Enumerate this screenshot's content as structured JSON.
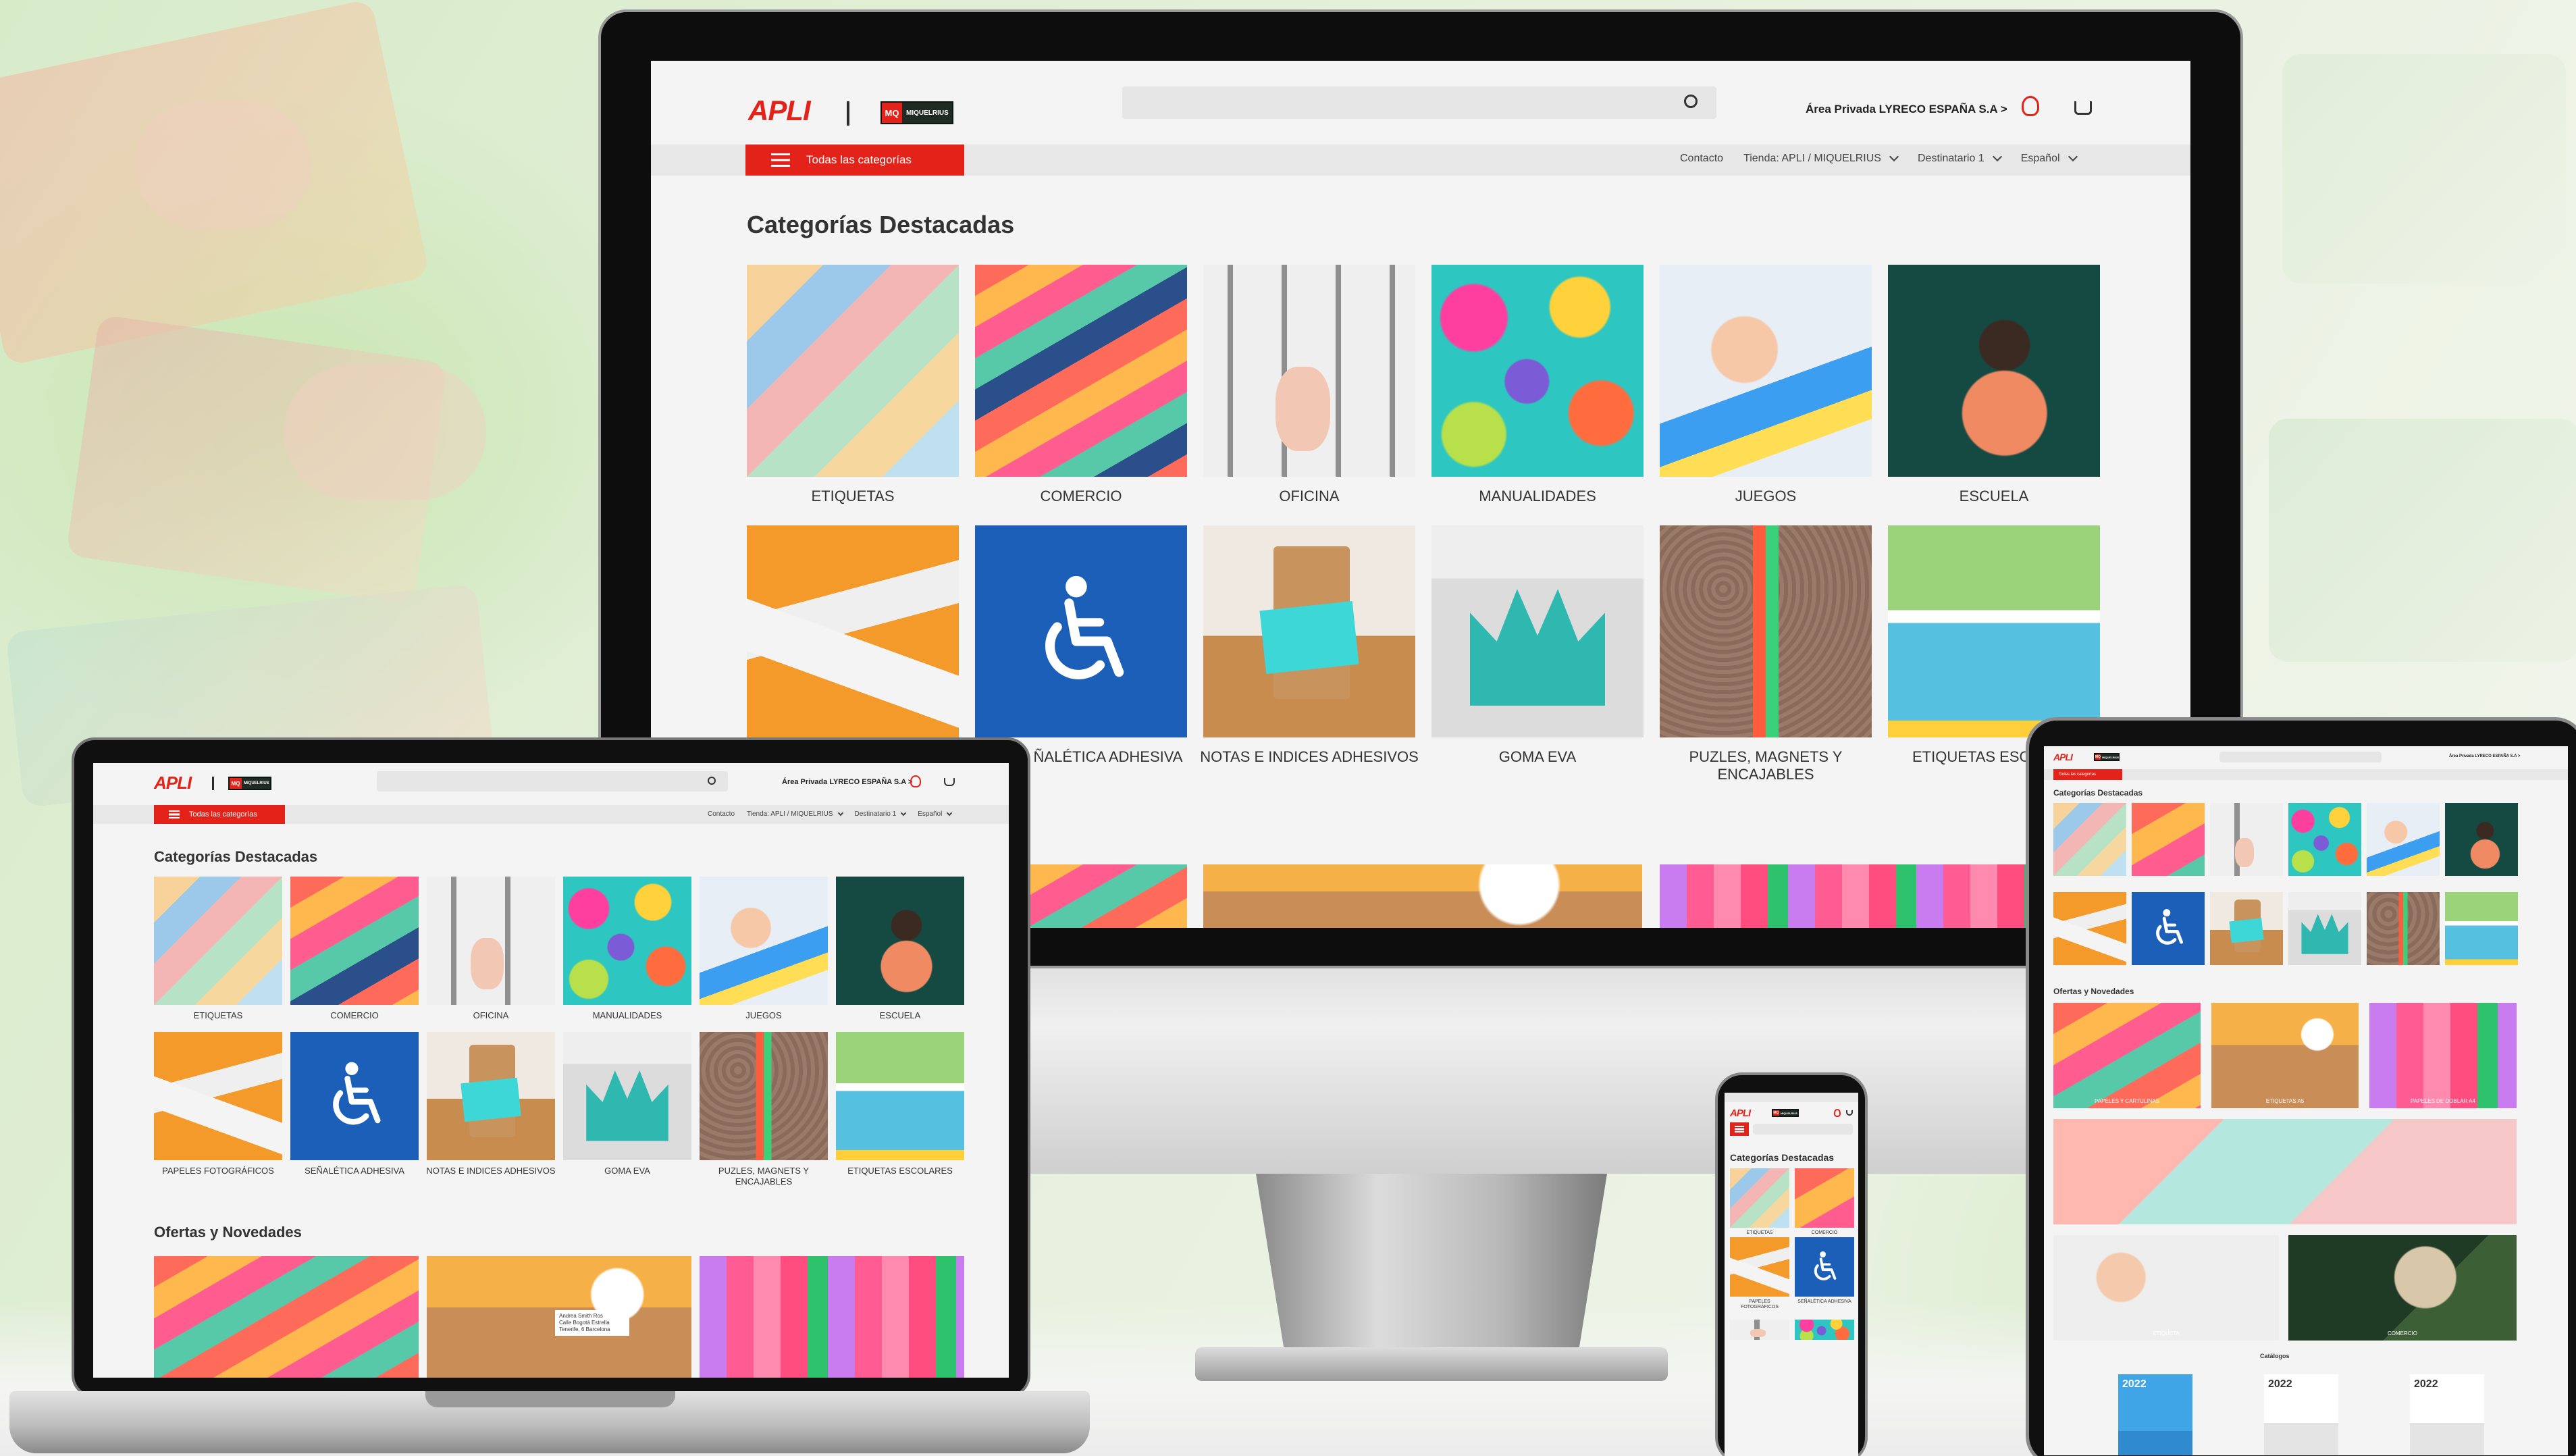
{
  "site": {
    "brand": "APLI",
    "brand2_badge": "MQ",
    "brand2_name": "MIQUELRIUS",
    "area_privada": "Área Privada LYRECO ESPAÑA S.A >",
    "all_categories": "Todas las categorías",
    "nav": {
      "contacto": "Contacto",
      "tienda": "Tienda: APLI / MIQUELRIUS",
      "destinatario": "Destinatario 1",
      "idioma": "Español"
    },
    "featured_title": "Categorías Destacadas",
    "offers_title": "Ofertas y Novedades",
    "catalog_title": "Catálogos"
  },
  "categories": [
    {
      "label": "ETIQUETAS",
      "image": "tags-photo"
    },
    {
      "label": "COMERCIO",
      "image": "colored-paper-photo"
    },
    {
      "label": "OFICINA",
      "image": "paperclips-photo"
    },
    {
      "label": "MANUALIDADES",
      "image": "confetti-photo"
    },
    {
      "label": "JUEGOS",
      "image": "kids-crafts-photo"
    },
    {
      "label": "ESCUELA",
      "image": "child-chalkboard-photo"
    },
    {
      "label": "PAPELES FOTOGRÁFICOS",
      "image": "photos-photo"
    },
    {
      "label": "SEÑALÉTICA ADHESIVA",
      "image": "wheelchair-icon"
    },
    {
      "label": "NOTAS E INDICES ADHESIVOS",
      "image": "coffee-cup-notes-photo"
    },
    {
      "label": "GOMA EVA",
      "image": "eva-crown-photo"
    },
    {
      "label": "PUZLES, MAGNETS Y ENCAJABLES",
      "image": "puzzle-blocks-photo"
    },
    {
      "label": "ETIQUETAS ESCOLARES",
      "image": "school-labels-photo"
    }
  ],
  "monitor_labels": {
    "senal_partial": "ÑALÉTICA ADHESIVA",
    "escolar_partial": "ETIQUETAS ESCO"
  },
  "tablet_offers": [
    {
      "label": "PAPELES Y CARTULINAS"
    },
    {
      "label": "ETIQUETAS A5"
    },
    {
      "label": "PAPELES DE DOBLAR A4"
    },
    {
      "label": ""
    },
    {
      "label": "ETIQUETA"
    },
    {
      "label": "COMERCIO"
    }
  ],
  "catalog_years": [
    "2022",
    "2022",
    "2022"
  ],
  "laptop_address": [
    "Andrea Smith Ros",
    "Calle Bogotá Estrella",
    "Tenerife, 6 Barcelona"
  ],
  "colors": {
    "brand_red": "#e32219",
    "page_bg": "#f4f4f4",
    "nav_bg": "#e7e7e7"
  }
}
